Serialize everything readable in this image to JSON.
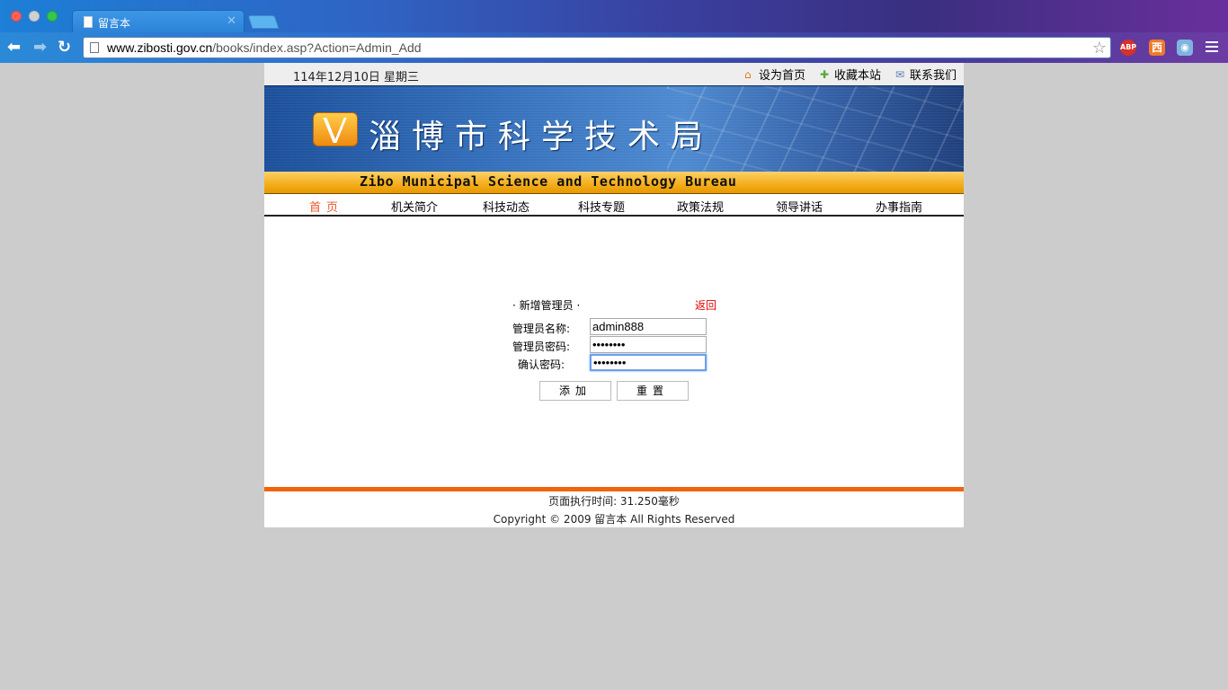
{
  "browser": {
    "tab_title": "留言本",
    "url_host": "www.zibosti.gov.cn",
    "url_path": "/books/index.asp?Action=Admin_Add",
    "extensions": {
      "abp": "ABP",
      "orange": "西",
      "camera": "◉"
    }
  },
  "topbar": {
    "date": "114年12月10日 星期三",
    "links": [
      "设为首页",
      "收藏本站",
      "联系我们"
    ]
  },
  "banner": {
    "title": "淄博市科学技术局",
    "subtitle": "Zibo Municipal Science and Technology Bureau"
  },
  "nav": [
    "首页",
    "机关简介",
    "科技动态",
    "科技专题",
    "政策法规",
    "领导讲话",
    "办事指南"
  ],
  "form": {
    "heading": "· 新增管理员 ·",
    "back": "返回",
    "fields": [
      {
        "label": "管理员名称:",
        "value": "admin888"
      },
      {
        "label": "管理员密码:",
        "value": "12345678"
      },
      {
        "label": "确认密码:",
        "value": "12345678"
      }
    ],
    "submit": "添加",
    "reset": "重置"
  },
  "footer": {
    "exec_time": "页面执行时间: 31.250毫秒",
    "copyright": "Copyright © 2009 留言本 All Rights Reserved"
  }
}
